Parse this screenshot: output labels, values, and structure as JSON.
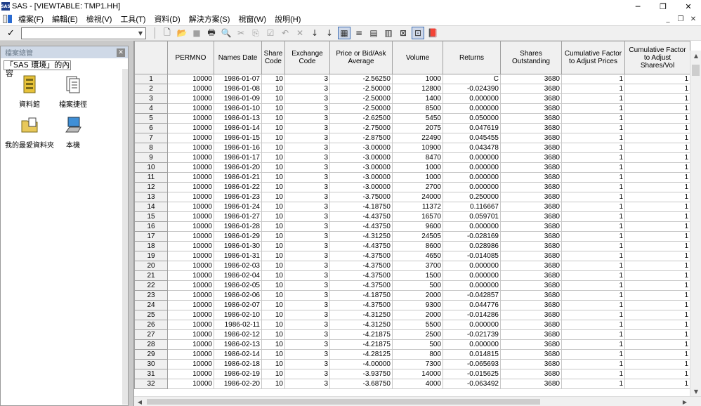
{
  "window": {
    "app_icon_text": "SAS",
    "title": "SAS - [VIEWTABLE: TMP1.HH]",
    "controls": [
      "─",
      "❐",
      "✕"
    ]
  },
  "menubar": {
    "items": [
      "檔案(F)",
      "編輯(E)",
      "檢視(V)",
      "工具(T)",
      "資料(D)",
      "解決方案(S)",
      "視窗(W)",
      "說明(H)"
    ],
    "mdi_controls": [
      "_",
      "❐",
      "✕"
    ]
  },
  "toolbar": {
    "command_value": "",
    "buttons": [
      {
        "name": "new-icon",
        "glyph": "🗋",
        "on": false,
        "dim": false
      },
      {
        "name": "open-icon",
        "glyph": "📂",
        "on": false,
        "dim": false
      },
      {
        "name": "save-icon",
        "glyph": "■",
        "on": false,
        "dim": true
      },
      {
        "name": "print-icon",
        "glyph": "🖶",
        "on": false,
        "dim": false
      },
      {
        "name": "print-preview-icon",
        "glyph": "🔍",
        "on": false,
        "dim": false
      },
      {
        "name": "cut-icon",
        "glyph": "✂",
        "on": false,
        "dim": true
      },
      {
        "name": "copy-icon",
        "glyph": "⎘",
        "on": false,
        "dim": true
      },
      {
        "name": "paste-icon",
        "glyph": "☑",
        "on": false,
        "dim": true
      },
      {
        "name": "undo-icon",
        "glyph": "↶",
        "on": false,
        "dim": true
      },
      {
        "name": "delete-icon",
        "glyph": "✕",
        "on": false,
        "dim": true
      },
      {
        "name": "sort-ascending-icon",
        "glyph": "↓",
        "on": false,
        "dim": false
      },
      {
        "name": "sort-descending-icon",
        "glyph": "↓",
        "on": false,
        "dim": false
      },
      {
        "name": "table-view-icon",
        "glyph": "▦",
        "on": true,
        "dim": false
      },
      {
        "name": "form-view-icon",
        "glyph": "≡",
        "on": false,
        "dim": false
      },
      {
        "name": "column-attributes-icon",
        "glyph": "▤",
        "on": false,
        "dim": false
      },
      {
        "name": "table-attributes-icon",
        "glyph": "▥",
        "on": false,
        "dim": false
      },
      {
        "name": "where-icon",
        "glyph": "⊠",
        "on": false,
        "dim": false
      },
      {
        "name": "edit-mode-icon",
        "glyph": "⊡",
        "on": true,
        "dim": false
      },
      {
        "name": "help-book-icon",
        "glyph": "📕",
        "on": false,
        "dim": false
      }
    ]
  },
  "explorer": {
    "title": "檔案總管",
    "scope": "「SAS 環境」的內容",
    "items": [
      {
        "label": "資料館",
        "icon": "library-icon"
      },
      {
        "label": "檔案捷徑",
        "icon": "file-shortcut-icon"
      },
      {
        "label": "我的最愛資料夾",
        "icon": "favorites-folder-icon"
      },
      {
        "label": "本機",
        "icon": "computer-icon"
      }
    ]
  },
  "table": {
    "columns": [
      "PERMNO",
      "Names Date",
      "Share Code",
      "Exchange Code",
      "Price or Bid/Ask Average",
      "Volume",
      "Returns",
      "Shares Outstanding",
      "Cumulative Factor to Adjust Prices",
      "Cumulative Factor to Adjust Shares/Vol"
    ],
    "rows": [
      [
        "1",
        "10000",
        "1986-01-07",
        "10",
        "3",
        "-2.56250",
        "1000",
        "C",
        "3680",
        "1",
        "1"
      ],
      [
        "2",
        "10000",
        "1986-01-08",
        "10",
        "3",
        "-2.50000",
        "12800",
        "-0.024390",
        "3680",
        "1",
        "1"
      ],
      [
        "3",
        "10000",
        "1986-01-09",
        "10",
        "3",
        "-2.50000",
        "1400",
        "0.000000",
        "3680",
        "1",
        "1"
      ],
      [
        "4",
        "10000",
        "1986-01-10",
        "10",
        "3",
        "-2.50000",
        "8500",
        "0.000000",
        "3680",
        "1",
        "1"
      ],
      [
        "5",
        "10000",
        "1986-01-13",
        "10",
        "3",
        "-2.62500",
        "5450",
        "0.050000",
        "3680",
        "1",
        "1"
      ],
      [
        "6",
        "10000",
        "1986-01-14",
        "10",
        "3",
        "-2.75000",
        "2075",
        "0.047619",
        "3680",
        "1",
        "1"
      ],
      [
        "7",
        "10000",
        "1986-01-15",
        "10",
        "3",
        "-2.87500",
        "22490",
        "0.045455",
        "3680",
        "1",
        "1"
      ],
      [
        "8",
        "10000",
        "1986-01-16",
        "10",
        "3",
        "-3.00000",
        "10900",
        "0.043478",
        "3680",
        "1",
        "1"
      ],
      [
        "9",
        "10000",
        "1986-01-17",
        "10",
        "3",
        "-3.00000",
        "8470",
        "0.000000",
        "3680",
        "1",
        "1"
      ],
      [
        "10",
        "10000",
        "1986-01-20",
        "10",
        "3",
        "-3.00000",
        "1000",
        "0.000000",
        "3680",
        "1",
        "1"
      ],
      [
        "11",
        "10000",
        "1986-01-21",
        "10",
        "3",
        "-3.00000",
        "1000",
        "0.000000",
        "3680",
        "1",
        "1"
      ],
      [
        "12",
        "10000",
        "1986-01-22",
        "10",
        "3",
        "-3.00000",
        "2700",
        "0.000000",
        "3680",
        "1",
        "1"
      ],
      [
        "13",
        "10000",
        "1986-01-23",
        "10",
        "3",
        "-3.75000",
        "24000",
        "0.250000",
        "3680",
        "1",
        "1"
      ],
      [
        "14",
        "10000",
        "1986-01-24",
        "10",
        "3",
        "-4.18750",
        "11372",
        "0.116667",
        "3680",
        "1",
        "1"
      ],
      [
        "15",
        "10000",
        "1986-01-27",
        "10",
        "3",
        "-4.43750",
        "16570",
        "0.059701",
        "3680",
        "1",
        "1"
      ],
      [
        "16",
        "10000",
        "1986-01-28",
        "10",
        "3",
        "-4.43750",
        "9600",
        "0.000000",
        "3680",
        "1",
        "1"
      ],
      [
        "17",
        "10000",
        "1986-01-29",
        "10",
        "3",
        "-4.31250",
        "24505",
        "-0.028169",
        "3680",
        "1",
        "1"
      ],
      [
        "18",
        "10000",
        "1986-01-30",
        "10",
        "3",
        "-4.43750",
        "8600",
        "0.028986",
        "3680",
        "1",
        "1"
      ],
      [
        "19",
        "10000",
        "1986-01-31",
        "10",
        "3",
        "-4.37500",
        "4650",
        "-0.014085",
        "3680",
        "1",
        "1"
      ],
      [
        "20",
        "10000",
        "1986-02-03",
        "10",
        "3",
        "-4.37500",
        "3700",
        "0.000000",
        "3680",
        "1",
        "1"
      ],
      [
        "21",
        "10000",
        "1986-02-04",
        "10",
        "3",
        "-4.37500",
        "1500",
        "0.000000",
        "3680",
        "1",
        "1"
      ],
      [
        "22",
        "10000",
        "1986-02-05",
        "10",
        "3",
        "-4.37500",
        "500",
        "0.000000",
        "3680",
        "1",
        "1"
      ],
      [
        "23",
        "10000",
        "1986-02-06",
        "10",
        "3",
        "-4.18750",
        "2000",
        "-0.042857",
        "3680",
        "1",
        "1"
      ],
      [
        "24",
        "10000",
        "1986-02-07",
        "10",
        "3",
        "-4.37500",
        "9300",
        "0.044776",
        "3680",
        "1",
        "1"
      ],
      [
        "25",
        "10000",
        "1986-02-10",
        "10",
        "3",
        "-4.31250",
        "2000",
        "-0.014286",
        "3680",
        "1",
        "1"
      ],
      [
        "26",
        "10000",
        "1986-02-11",
        "10",
        "3",
        "-4.31250",
        "5500",
        "0.000000",
        "3680",
        "1",
        "1"
      ],
      [
        "27",
        "10000",
        "1986-02-12",
        "10",
        "3",
        "-4.21875",
        "2500",
        "-0.021739",
        "3680",
        "1",
        "1"
      ],
      [
        "28",
        "10000",
        "1986-02-13",
        "10",
        "3",
        "-4.21875",
        "500",
        "0.000000",
        "3680",
        "1",
        "1"
      ],
      [
        "29",
        "10000",
        "1986-02-14",
        "10",
        "3",
        "-4.28125",
        "800",
        "0.014815",
        "3680",
        "1",
        "1"
      ],
      [
        "30",
        "10000",
        "1986-02-18",
        "10",
        "3",
        "-4.00000",
        "7300",
        "-0.065693",
        "3680",
        "1",
        "1"
      ],
      [
        "31",
        "10000",
        "1986-02-19",
        "10",
        "3",
        "-3.93750",
        "14000",
        "-0.015625",
        "3680",
        "1",
        "1"
      ],
      [
        "32",
        "10000",
        "1986-02-20",
        "10",
        "3",
        "-3.68750",
        "4000",
        "-0.063492",
        "3680",
        "1",
        "1"
      ]
    ]
  }
}
